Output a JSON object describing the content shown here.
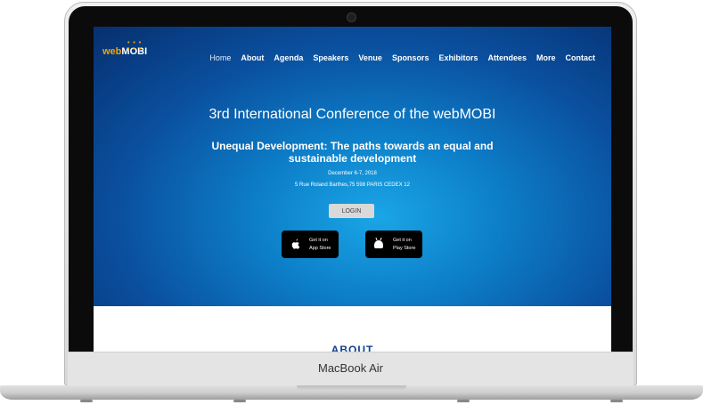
{
  "site": {
    "logo": {
      "web": "web",
      "mobi": "MOBI",
      "dots": "• • • • • •"
    },
    "nav": [
      "Home",
      "About",
      "Agenda",
      "Speakers",
      "Venue",
      "Sponsors",
      "Exhibitors",
      "Attendees",
      "More",
      "Contact"
    ],
    "active_nav": "Home"
  },
  "hero": {
    "title": "3rd International Conference of the webMOBI",
    "subtitle": "Unequal Development: The paths towards an equal and sustainable development",
    "date": "December 6-7, 2018",
    "address": "5 Rue Roland Barthes,75 598 PARIS CEDEX 12",
    "login_label": "LOGIN",
    "app_store": {
      "line1": "Get it on",
      "line2": "App Store"
    },
    "play_store": {
      "line1": "Get it on",
      "line2": "Play Store"
    }
  },
  "section_peek": "ABOUT",
  "device": {
    "model_label": "MacBook Air"
  },
  "colors": {
    "brand_orange": "#f5a400",
    "hero_blue": "#0a4f9e",
    "login_bg": "#d9d9d9"
  }
}
